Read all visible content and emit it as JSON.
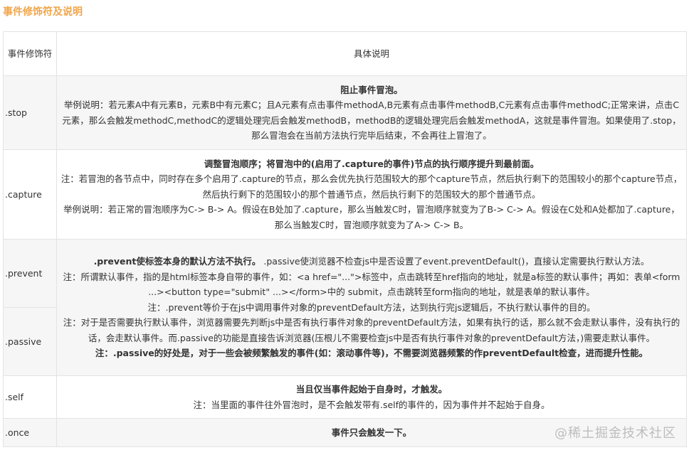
{
  "page_title": "事件修饰符及说明",
  "header": {
    "col1": "事件修饰符",
    "col2": "具体说明"
  },
  "rows": {
    "stop": {
      "name": ".stop",
      "bold": "阻止事件冒泡。",
      "lines": [
        "举例说明：若元素A中有元素B，元素B中有元素C；且A元素有点击事件methodA,B元素有点击事件methodB,C元素有点击事件methodC;正常来讲，点击C元素，那么会触发methodC,methodC的逻辑处理完后会触发methodB，methodB的逻辑处理完后会触发methodA，这就是事件冒泡。如果使用了.stop，那么冒泡会在当前方法执行完毕后结束，不会再往上冒泡了。"
      ]
    },
    "capture": {
      "name": ".capture",
      "bold": "调整冒泡顺序；将冒泡中的(启用了.capture的事件)节点的执行顺序提升到最前面。",
      "lines": [
        "注：若冒泡的各节点中，同时存在多个启用了.capture的节点，那么会优先执行范围较大的那个capture节点，然后执行剩下的范围较小的那个capture节点，然后执行剩下的范围较小的那个普通节点，然后执行剩下的范围较大的那个普通节点。",
        "举例说明：若正常的冒泡顺序为C-> B-> A。假设在B处加了.capture，那么当触发C时，冒泡顺序就变为了B-> C-> A。假设在C处和A处都加了.capture，那么当触发C时，冒泡顺序就变为了A-> C-> B。"
      ]
    },
    "prevent_passive": {
      "name_prevent": ".prevent",
      "name_passive": ".passive",
      "bold_prevent": ".prevent使标签本身的默认方法不执行。",
      "passive_intro": " .passive使浏览器不检查js中是否设置了event.preventDefault()，直接认定需要执行默认方法。",
      "lines": [
        "注：所谓默认事件，指的是html标签本身自带的事件，如：<a href=\"...\">标签中，点击跳转至href指向的地址，就是a标签的默认事件；再如：表单<form ...><button type=\"submit\" ...></form>中的 submit，点击跳转至form指向的地址，就是表单的默认事件。",
        "注：.prevent等价于在js中调用事件对象的preventDefault方法，达到执行完js逻辑后，不执行默认事件的目的。",
        "注：对于是否需要执行默认事件，浏览器需要先判断js中是否有执行事件对象的preventDefault方法，如果有执行的话，那么就不会走默认事件，没有执行的话，会走默认事件。而.passive的功能是直接告诉浏览器(压根儿不需要检查js中是否有执行事件对象的preventDefault方法，)需要走默认事件。"
      ],
      "bold_note": "注：.passive的好处是，对于一些会被频繁触发的事件(如：滚动事件等)，不需要浏览器频繁的作preventDefault检查，进而提升性能。"
    },
    "self": {
      "name": ".self",
      "bold": "当且仅当事件起始于自身时，才触发。",
      "lines": [
        "注：当里面的事件往外冒泡时，是不会触发带有.self的事件的，因为事件并不起始于自身。"
      ]
    },
    "once": {
      "name": ".once",
      "bold": "事件只会触发一下。"
    }
  },
  "watermark": "@稀土掘金技术社区"
}
